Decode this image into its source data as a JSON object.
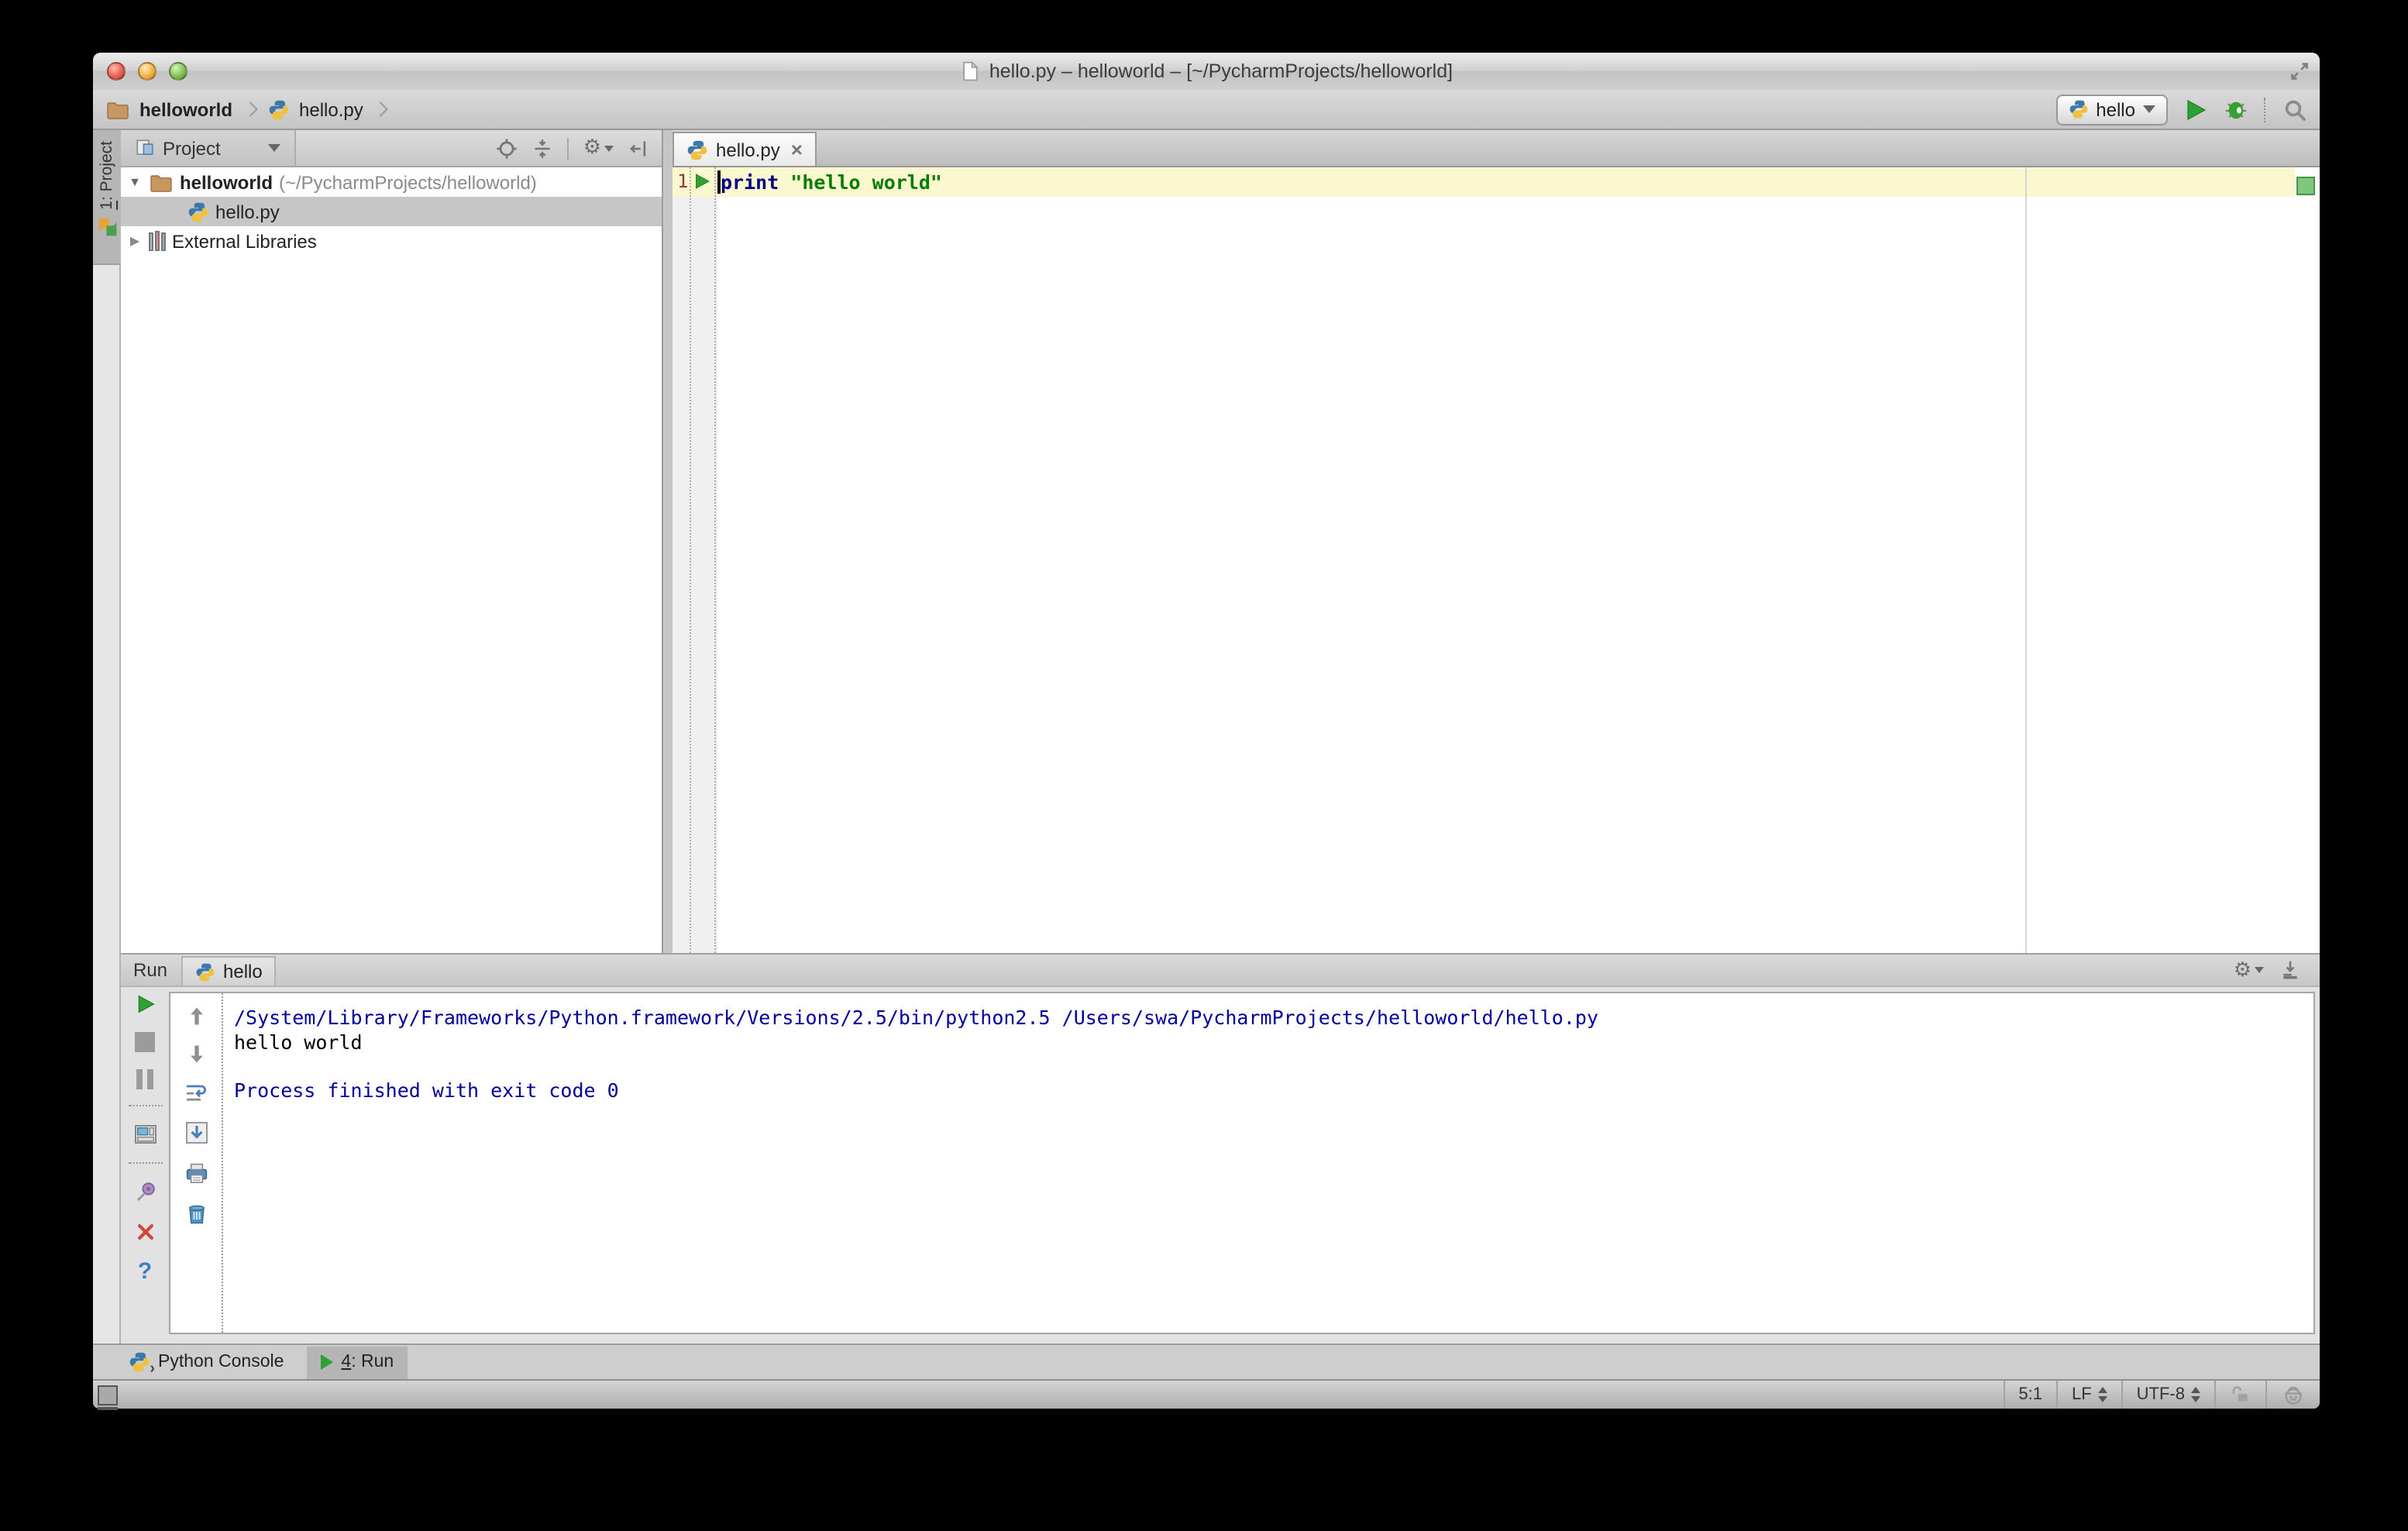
{
  "window_title": "hello.py – helloworld – [~/PycharmProjects/helloworld]",
  "breadcrumb": {
    "project": "helloworld",
    "file": "hello.py"
  },
  "toolbar": {
    "run_config": "hello"
  },
  "left_stripe": {
    "tab_number": "1",
    "tab_suffix": ": Project"
  },
  "project_panel": {
    "title": "Project",
    "root_label": "helloworld",
    "root_path": "(~/PycharmProjects/helloworld)",
    "file": "hello.py",
    "external_libraries": "External Libraries"
  },
  "editor": {
    "tab": "hello.py",
    "close": "×",
    "line_number": "1",
    "keyword": "print",
    "string": "\"hello world\""
  },
  "run_panel": {
    "title": "Run",
    "tab": "hello",
    "console_line1": "/System/Library/Frameworks/Python.framework/Versions/2.5/bin/python2.5 /Users/swa/PycharmProjects/helloworld/hello.py",
    "console_line2": "hello world",
    "console_line4": "Process finished with exit code 0",
    "help_label": "?"
  },
  "toolwindow_bar": {
    "python_console": "Python Console",
    "run_number": "4",
    "run_suffix": ": Run"
  },
  "statusbar": {
    "caret_position": "5:1",
    "line_separator": "LF",
    "encoding": "UTF-8"
  },
  "colors": {
    "run_green": "#2fa033",
    "keyword_blue": "#000080",
    "string_green": "#007d00",
    "console_info_blue": "#00009b",
    "current_line_highlight": "#fbf7cf",
    "inspection_ok_green": "#7cc87c"
  }
}
